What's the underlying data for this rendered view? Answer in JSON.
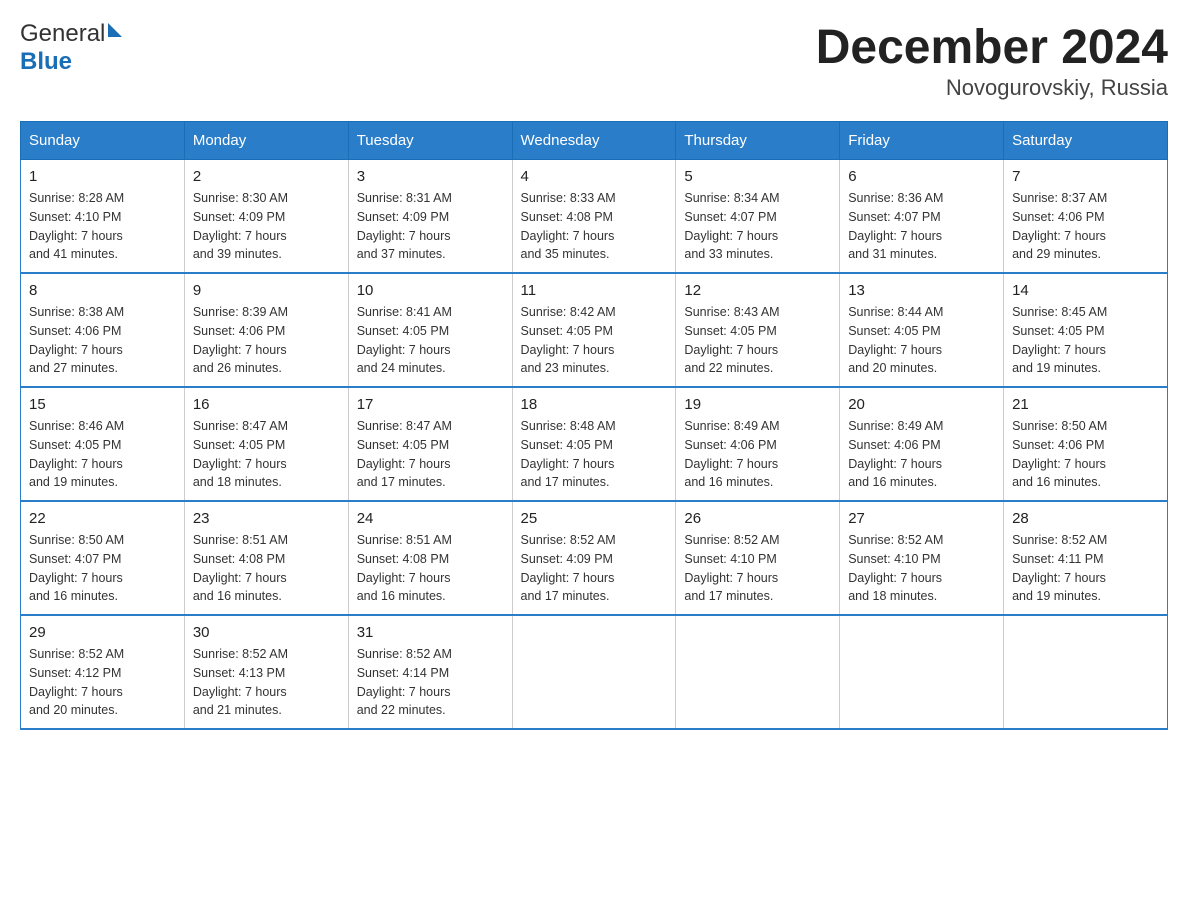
{
  "header": {
    "logo_general": "General",
    "logo_blue": "Blue",
    "title": "December 2024",
    "subtitle": "Novogurovskiy, Russia"
  },
  "columns": [
    "Sunday",
    "Monday",
    "Tuesday",
    "Wednesday",
    "Thursday",
    "Friday",
    "Saturday"
  ],
  "weeks": [
    [
      {
        "day": "1",
        "sunrise": "8:28 AM",
        "sunset": "4:10 PM",
        "daylight": "7 hours and 41 minutes."
      },
      {
        "day": "2",
        "sunrise": "8:30 AM",
        "sunset": "4:09 PM",
        "daylight": "7 hours and 39 minutes."
      },
      {
        "day": "3",
        "sunrise": "8:31 AM",
        "sunset": "4:09 PM",
        "daylight": "7 hours and 37 minutes."
      },
      {
        "day": "4",
        "sunrise": "8:33 AM",
        "sunset": "4:08 PM",
        "daylight": "7 hours and 35 minutes."
      },
      {
        "day": "5",
        "sunrise": "8:34 AM",
        "sunset": "4:07 PM",
        "daylight": "7 hours and 33 minutes."
      },
      {
        "day": "6",
        "sunrise": "8:36 AM",
        "sunset": "4:07 PM",
        "daylight": "7 hours and 31 minutes."
      },
      {
        "day": "7",
        "sunrise": "8:37 AM",
        "sunset": "4:06 PM",
        "daylight": "7 hours and 29 minutes."
      }
    ],
    [
      {
        "day": "8",
        "sunrise": "8:38 AM",
        "sunset": "4:06 PM",
        "daylight": "7 hours and 27 minutes."
      },
      {
        "day": "9",
        "sunrise": "8:39 AM",
        "sunset": "4:06 PM",
        "daylight": "7 hours and 26 minutes."
      },
      {
        "day": "10",
        "sunrise": "8:41 AM",
        "sunset": "4:05 PM",
        "daylight": "7 hours and 24 minutes."
      },
      {
        "day": "11",
        "sunrise": "8:42 AM",
        "sunset": "4:05 PM",
        "daylight": "7 hours and 23 minutes."
      },
      {
        "day": "12",
        "sunrise": "8:43 AM",
        "sunset": "4:05 PM",
        "daylight": "7 hours and 22 minutes."
      },
      {
        "day": "13",
        "sunrise": "8:44 AM",
        "sunset": "4:05 PM",
        "daylight": "7 hours and 20 minutes."
      },
      {
        "day": "14",
        "sunrise": "8:45 AM",
        "sunset": "4:05 PM",
        "daylight": "7 hours and 19 minutes."
      }
    ],
    [
      {
        "day": "15",
        "sunrise": "8:46 AM",
        "sunset": "4:05 PM",
        "daylight": "7 hours and 19 minutes."
      },
      {
        "day": "16",
        "sunrise": "8:47 AM",
        "sunset": "4:05 PM",
        "daylight": "7 hours and 18 minutes."
      },
      {
        "day": "17",
        "sunrise": "8:47 AM",
        "sunset": "4:05 PM",
        "daylight": "7 hours and 17 minutes."
      },
      {
        "day": "18",
        "sunrise": "8:48 AM",
        "sunset": "4:05 PM",
        "daylight": "7 hours and 17 minutes."
      },
      {
        "day": "19",
        "sunrise": "8:49 AM",
        "sunset": "4:06 PM",
        "daylight": "7 hours and 16 minutes."
      },
      {
        "day": "20",
        "sunrise": "8:49 AM",
        "sunset": "4:06 PM",
        "daylight": "7 hours and 16 minutes."
      },
      {
        "day": "21",
        "sunrise": "8:50 AM",
        "sunset": "4:06 PM",
        "daylight": "7 hours and 16 minutes."
      }
    ],
    [
      {
        "day": "22",
        "sunrise": "8:50 AM",
        "sunset": "4:07 PM",
        "daylight": "7 hours and 16 minutes."
      },
      {
        "day": "23",
        "sunrise": "8:51 AM",
        "sunset": "4:08 PM",
        "daylight": "7 hours and 16 minutes."
      },
      {
        "day": "24",
        "sunrise": "8:51 AM",
        "sunset": "4:08 PM",
        "daylight": "7 hours and 16 minutes."
      },
      {
        "day": "25",
        "sunrise": "8:52 AM",
        "sunset": "4:09 PM",
        "daylight": "7 hours and 17 minutes."
      },
      {
        "day": "26",
        "sunrise": "8:52 AM",
        "sunset": "4:10 PM",
        "daylight": "7 hours and 17 minutes."
      },
      {
        "day": "27",
        "sunrise": "8:52 AM",
        "sunset": "4:10 PM",
        "daylight": "7 hours and 18 minutes."
      },
      {
        "day": "28",
        "sunrise": "8:52 AM",
        "sunset": "4:11 PM",
        "daylight": "7 hours and 19 minutes."
      }
    ],
    [
      {
        "day": "29",
        "sunrise": "8:52 AM",
        "sunset": "4:12 PM",
        "daylight": "7 hours and 20 minutes."
      },
      {
        "day": "30",
        "sunrise": "8:52 AM",
        "sunset": "4:13 PM",
        "daylight": "7 hours and 21 minutes."
      },
      {
        "day": "31",
        "sunrise": "8:52 AM",
        "sunset": "4:14 PM",
        "daylight": "7 hours and 22 minutes."
      },
      null,
      null,
      null,
      null
    ]
  ],
  "labels": {
    "sunrise": "Sunrise:",
    "sunset": "Sunset:",
    "daylight": "Daylight:"
  }
}
